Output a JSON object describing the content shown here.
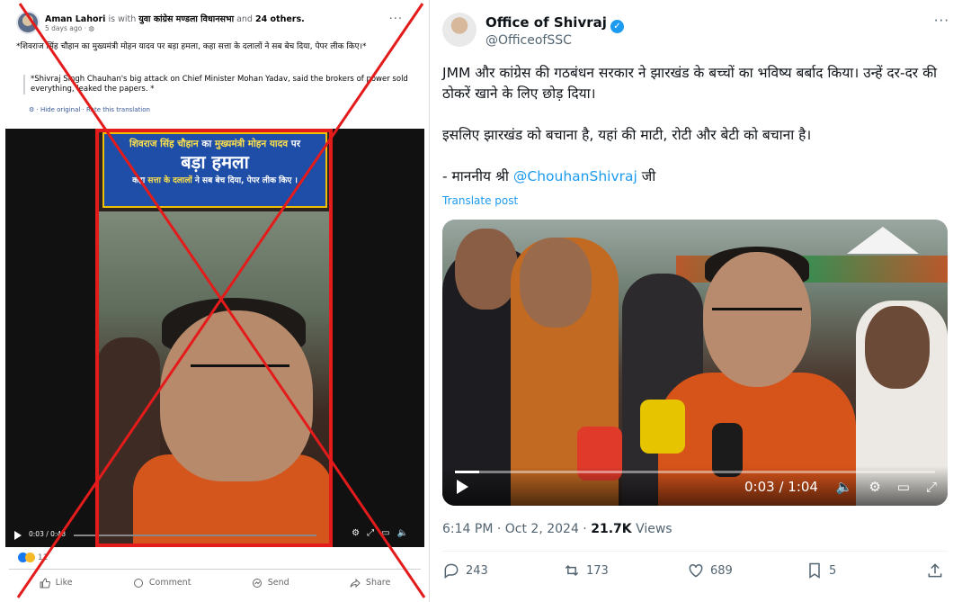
{
  "facebook": {
    "author": "Aman Lahori",
    "with_text": "is with",
    "group": "युवा कांग्रेस मण्डला विधानसभा",
    "and_text": "and",
    "others": "24 others.",
    "time": "5 days ago · ◍",
    "post_text": "*शिवराज सिंह चौहान का मुख्यमंत्री मोहन यादव पर बड़ा हमला, कहा सत्ता के दलालों ने सब बेच दिया, पेपर लीक किए।*",
    "translation": "*Shivraj Singh Chauhan's big attack on Chief Minister Mohan Yadav, said the brokers of power sold everything, leaked the papers. *",
    "hide_original": "Hide original",
    "rate_translation": "Rate this translation",
    "banner_line1_a": "शिवराज सिंह चौहान",
    "banner_line1_b": "का",
    "banner_line1_c": "मुख्यमंत्री मोहन यादव",
    "banner_line1_d": "पर",
    "banner_line2": "बड़ा हमला",
    "banner_line3_a": "कहा",
    "banner_line3_b": "सत्ता के दलालों",
    "banner_line3_c": "ने सब बेच दिया, पेपर लीक किए ।",
    "video_time": "0:03 / 0:48",
    "reaction_count": "11",
    "actions": {
      "like": "Like",
      "comment": "Comment",
      "send": "Send",
      "share": "Share"
    }
  },
  "x": {
    "name": "Office of Shivraj",
    "handle": "@OfficeofSSC",
    "text_p1": "JMM और कांग्रेस की गठबंधन सरकार ने झारखंड के बच्चों का भविष्य बर्बाद किया। उन्हें दर-दर की ठोकरें खाने के लिए छोड़ दिया।",
    "text_p2": "इसलिए झारखंड को बचाना है, यहां की माटी, रोटी और बेटी को बचाना है।",
    "text_p3_prefix": "- माननीय श्री",
    "text_p3_mention": "@ChouhanShivraj",
    "text_p3_suffix": "जी",
    "translate": "Translate post",
    "video_time": "0:03 / 1:04",
    "video_progress": 0.05,
    "timestamp": "6:14 PM · Oct 2, 2024 ·",
    "views_count": "21.7K",
    "views_label": "Views",
    "replies": "243",
    "reposts": "173",
    "likes": "689",
    "bookmarks": "5"
  },
  "colors": {
    "x_blue": "#1d9bf0",
    "fb_blue": "#1877f2",
    "cross_red": "#e41b1b"
  }
}
